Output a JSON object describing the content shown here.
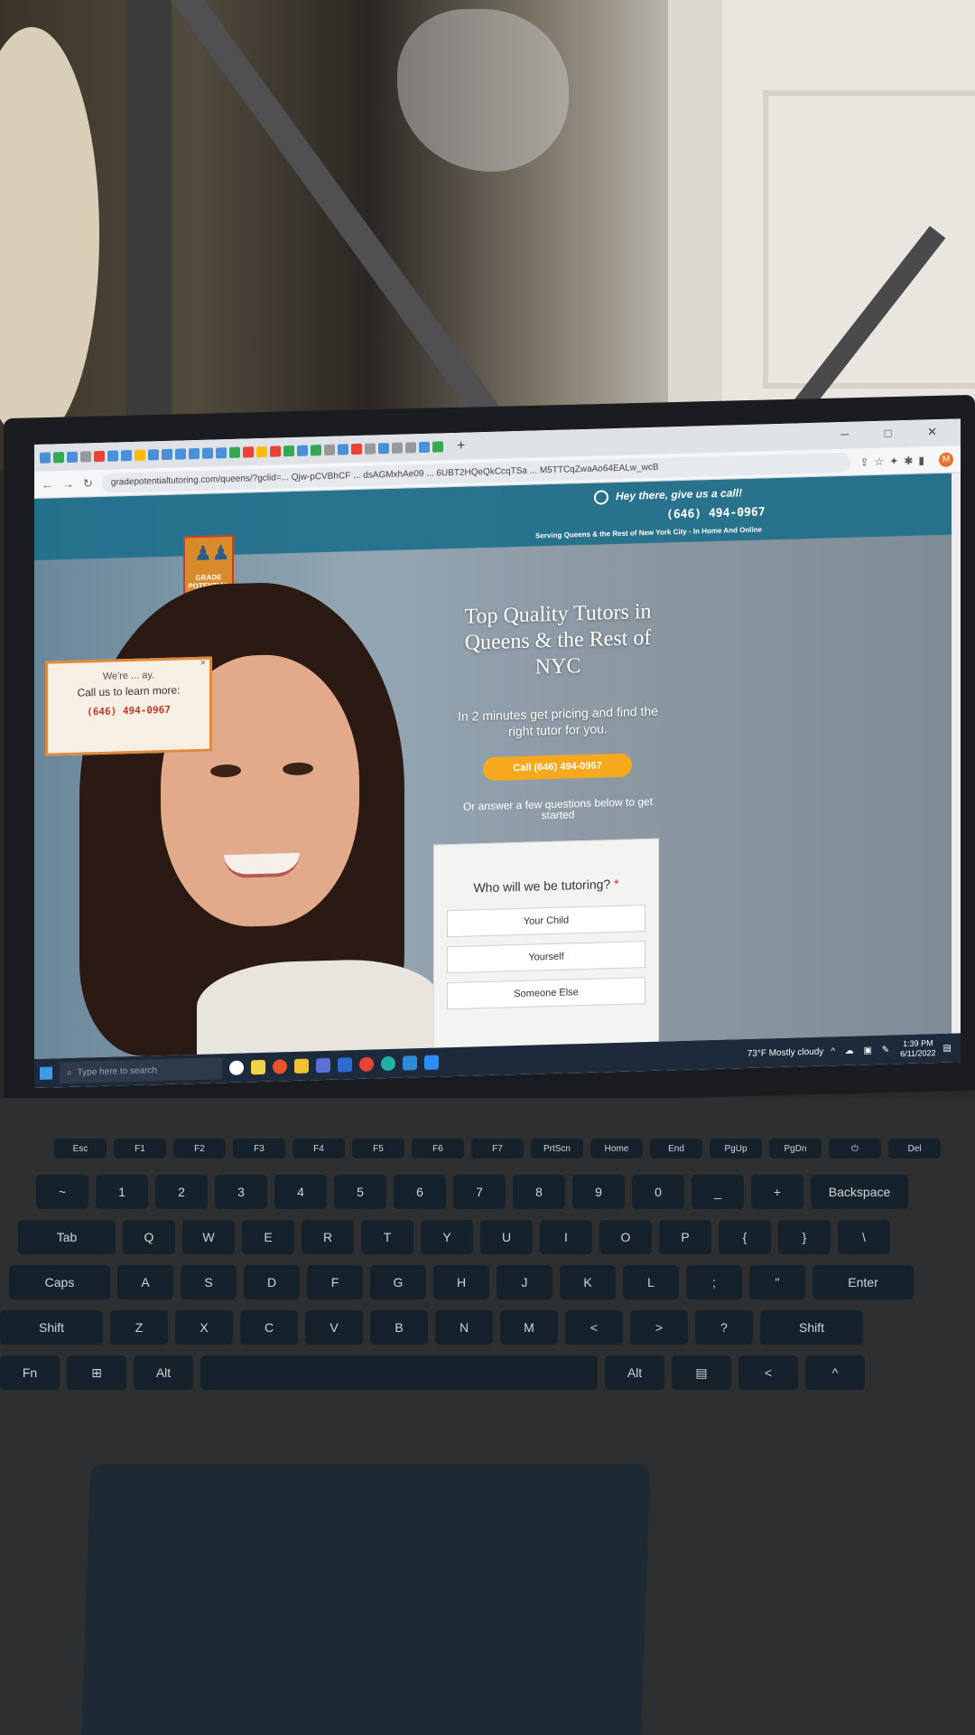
{
  "browser": {
    "url": "gradepotentialtutoring.com/queens/?gclid=... Qjw-pCVBhCF ... dsAGMxhAe09 ... 6UBT2HQeQkCcqTSa ... M5TTCqZwaAo64EALw_wcB",
    "new_tab_glyph": "+",
    "window_controls": "─ □ ✕",
    "profile_initial": "M"
  },
  "site": {
    "header": {
      "callout": "Hey there, give us a call!",
      "phone": "(646) 494-0967",
      "serving": "Serving Queens & the Rest of New York City - In Home And Online"
    },
    "logo": {
      "line1": "GRADE",
      "line2": "POTENTIAL"
    },
    "promo": {
      "line1": "We're ... ay.",
      "line2": "Call us to learn more:",
      "phone": "(646) 494-0967",
      "close": "×"
    },
    "hero": {
      "title": "Top Quality Tutors in Queens & the Rest of NYC",
      "subtitle": "In 2 minutes get pricing and find the right tutor for you.",
      "cta": "Call (646) 494-0967",
      "or_text": "Or answer a few questions below to get started"
    },
    "form": {
      "question": "Who will we be tutoring?",
      "required_mark": "*",
      "options": [
        "Your Child",
        "Yourself",
        "Someone Else"
      ]
    }
  },
  "taskbar": {
    "search_placeholder": "Type here to search",
    "weather": "73°F  Mostly cloudy",
    "time": "1:39 PM",
    "date": "6/11/2022"
  },
  "keyboard": {
    "row0": [
      "Esc",
      "F1",
      "F2",
      "F3",
      "F4",
      "F5",
      "F6",
      "F7",
      "PrtScn",
      "Home",
      "End",
      "PgUp",
      "PgDn",
      "⏻",
      "Del"
    ],
    "row1": [
      "~",
      "1",
      "2",
      "3",
      "4",
      "5",
      "6",
      "7",
      "8",
      "9",
      "0",
      "_",
      "+",
      "Backspace"
    ],
    "row2": [
      "Tab",
      "Q",
      "W",
      "E",
      "R",
      "T",
      "Y",
      "U",
      "I",
      "O",
      "P",
      "{",
      "}",
      "\\"
    ],
    "row3": [
      "Caps",
      "A",
      "S",
      "D",
      "F",
      "G",
      "H",
      "J",
      "K",
      "L",
      ";",
      "\"",
      "Enter"
    ],
    "row4": [
      "Shift",
      "Z",
      "X",
      "C",
      "V",
      "B",
      "N",
      "M",
      "<",
      ">",
      "?",
      "Shift"
    ],
    "row5": [
      "Fn",
      "⊞",
      "Alt",
      "",
      "Alt",
      "▤",
      "<",
      "^"
    ]
  },
  "colors": {
    "header_blue": "#1f6f8b",
    "cta_orange": "#f6a91c",
    "promo_border": "#e08a3e",
    "required_red": "#c0392b"
  }
}
